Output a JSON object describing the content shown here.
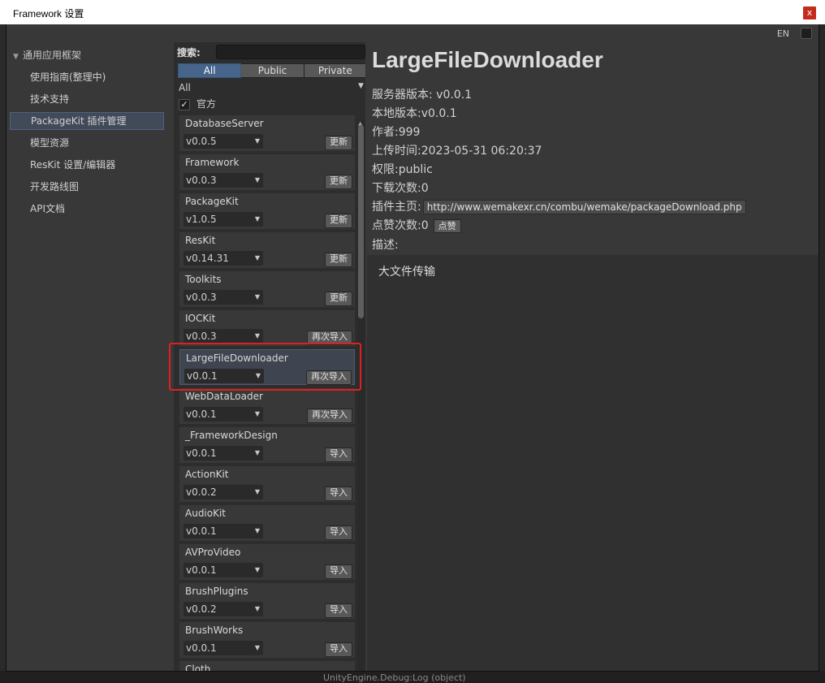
{
  "window": {
    "title": "Framework 设置",
    "close_label": "x"
  },
  "lang": {
    "label": "EN"
  },
  "nav": {
    "group": "通用应用框架",
    "items": [
      {
        "label": "使用指南(整理中)"
      },
      {
        "label": "技术支持"
      },
      {
        "label": "PackageKit 插件管理",
        "selected": true
      },
      {
        "label": "模型资源"
      },
      {
        "label": "ResKit 设置/编辑器"
      },
      {
        "label": "开发路线图"
      },
      {
        "label": "API文档"
      }
    ]
  },
  "search": {
    "label": "搜索:",
    "value": ""
  },
  "tabs": [
    {
      "label": "All",
      "active": true
    },
    {
      "label": "Public"
    },
    {
      "label": "Private"
    }
  ],
  "filter": {
    "selected": "All"
  },
  "official": {
    "label": "官方",
    "checked": true
  },
  "packages": [
    {
      "name": "DatabaseServer",
      "version": "v0.0.5",
      "action": "更新"
    },
    {
      "name": "Framework",
      "version": "v0.0.3",
      "action": "更新"
    },
    {
      "name": "PackageKit",
      "version": "v1.0.5",
      "action": "更新"
    },
    {
      "name": "ResKit",
      "version": "v0.14.31",
      "action": "更新"
    },
    {
      "name": "Toolkits",
      "version": "v0.0.3",
      "action": "更新"
    },
    {
      "name": "IOCKit",
      "version": "v0.0.3",
      "action": "再次导入"
    },
    {
      "name": "LargeFileDownloader",
      "version": "v0.0.1",
      "action": "再次导入",
      "highlight": true
    },
    {
      "name": "WebDataLoader",
      "version": "v0.0.1",
      "action": "再次导入"
    },
    {
      "name": "_FrameworkDesign",
      "version": "v0.0.1",
      "action": "导入"
    },
    {
      "name": "ActionKit",
      "version": "v0.0.2",
      "action": "导入"
    },
    {
      "name": "AudioKit",
      "version": "v0.0.1",
      "action": "导入"
    },
    {
      "name": "AVProVideo",
      "version": "v0.0.1",
      "action": "导入"
    },
    {
      "name": "BrushPlugins",
      "version": "v0.0.2",
      "action": "导入"
    },
    {
      "name": "BrushWorks",
      "version": "v0.0.1",
      "action": "导入"
    },
    {
      "name": "Cloth",
      "version": "",
      "action": ""
    }
  ],
  "detail": {
    "title": "LargeFileDownloader",
    "server_version": "服务器版本: v0.0.1",
    "local_version": "本地版本:v0.0.1",
    "author": "作者:999",
    "upload_time": "上传时间:2023-05-31 06:20:37",
    "permission": "权限:public",
    "downloads": "下载次数:0",
    "homepage_label": "插件主页:",
    "homepage_url": "http://www.wemakexr.cn/combu/wemake/packageDownload.php",
    "likes": "点赞次数:0",
    "like_button": "点赞",
    "description_label": "描述:",
    "description": "大文件传输"
  },
  "background": {
    "console_text": "UnityEngine.Debug:Log (object)"
  }
}
